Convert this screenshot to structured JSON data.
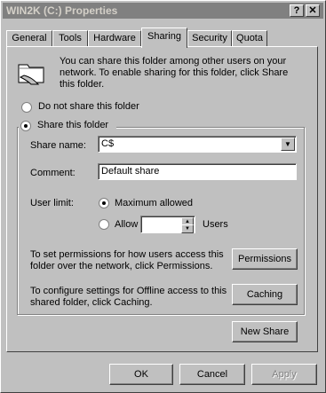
{
  "window": {
    "title": "WIN2K (C:) Properties",
    "help_glyph": "?",
    "close_glyph": "✕"
  },
  "tabs": [
    {
      "label": "General"
    },
    {
      "label": "Tools"
    },
    {
      "label": "Hardware"
    },
    {
      "label": "Sharing"
    },
    {
      "label": "Security"
    },
    {
      "label": "Quota"
    }
  ],
  "sharing": {
    "intro": "You can share this folder among other users on your network.  To enable sharing for this folder, click Share this folder.",
    "do_not_share_label": "Do not share this folder",
    "share_label": "Share this folder",
    "share_name_label": "Share name:",
    "share_name_value": "C$",
    "comment_label": "Comment:",
    "comment_value": "Default share",
    "user_limit_label": "User limit:",
    "max_allowed_label": "Maximum allowed",
    "allow_label": "Allow",
    "users_label": "Users",
    "permissions_text": "To set permissions for how users access this folder over the network, click Permissions.",
    "permissions_button": "Permissions",
    "caching_text": "To configure settings for Offline access to this shared folder, click Caching.",
    "caching_button": "Caching",
    "new_share_button": "New Share"
  },
  "footer": {
    "ok": "OK",
    "cancel": "Cancel",
    "apply": "Apply"
  }
}
